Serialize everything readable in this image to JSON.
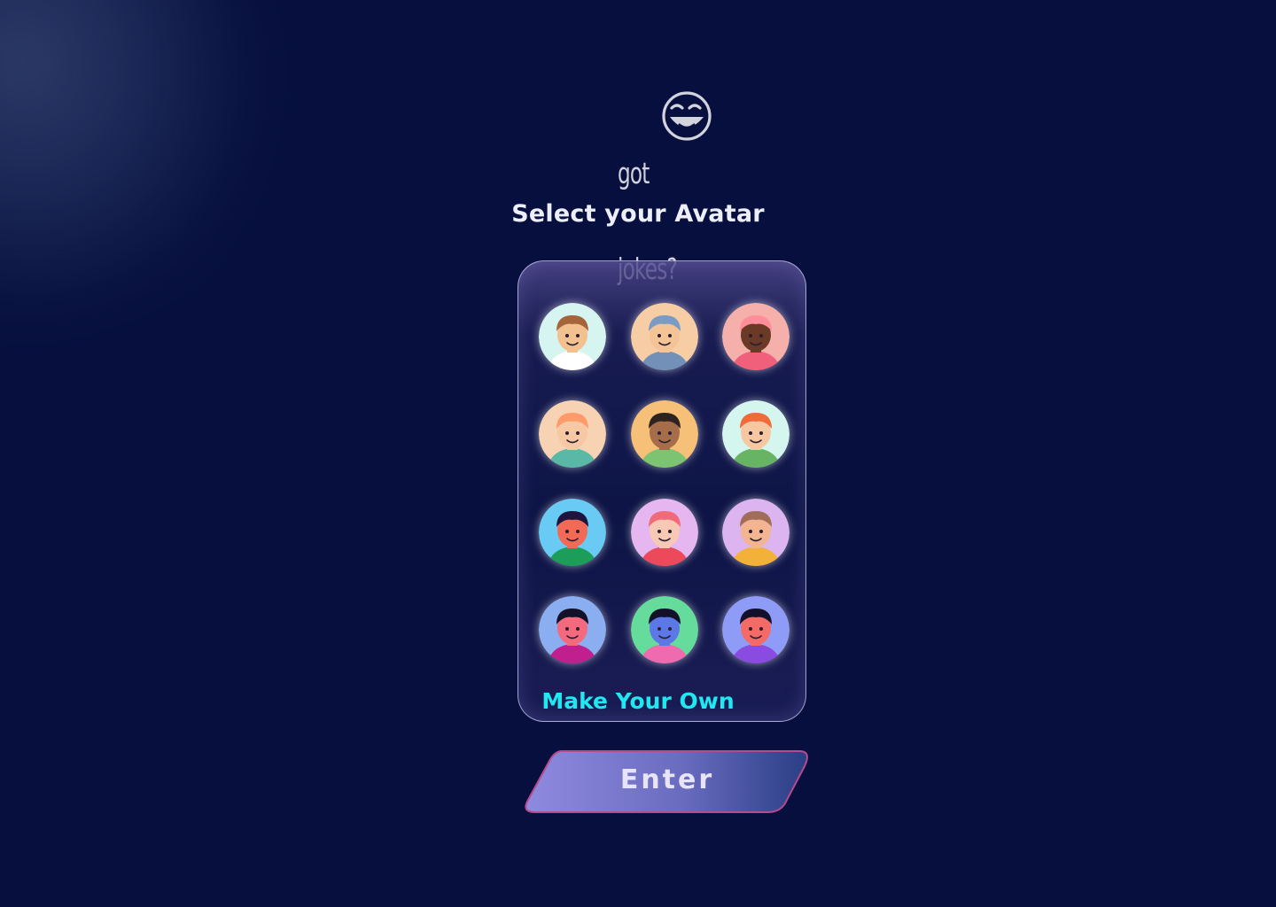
{
  "logo": {
    "line1": "got",
    "line2": "jokes?",
    "icon": "laughing-face-icon"
  },
  "title": "Select your Avatar",
  "avatars": [
    {
      "name": "avatar-1",
      "bg": "#d6f5f0",
      "skin": "#f2c18f",
      "hair": "#a4653a",
      "shirt": "#ffffff"
    },
    {
      "name": "avatar-2",
      "bg": "#f6cda4",
      "skin": "#f4c396",
      "hair": "#7a9bc4",
      "shirt": "#7391b8"
    },
    {
      "name": "avatar-3",
      "bg": "#f5b0ac",
      "skin": "#6b3a26",
      "hair": "#ff8e9a",
      "shirt": "#f0607a"
    },
    {
      "name": "avatar-4",
      "bg": "#f7d3b4",
      "skin": "#f6c8a4",
      "hair": "#ff9a6a",
      "shirt": "#59b9a6"
    },
    {
      "name": "avatar-5",
      "bg": "#f7c079",
      "skin": "#a56d4a",
      "hair": "#2f2320",
      "shirt": "#7cc471"
    },
    {
      "name": "avatar-6",
      "bg": "#d5f6ee",
      "skin": "#f7c7a2",
      "hair": "#f06a3a",
      "shirt": "#67b464"
    },
    {
      "name": "avatar-7",
      "bg": "#69cbf3",
      "skin": "#f26a55",
      "hair": "#1d1540",
      "shirt": "#1c9e5a"
    },
    {
      "name": "avatar-8",
      "bg": "#e5b6f0",
      "skin": "#f7c9b5",
      "hair": "#f06a7a",
      "shirt": "#ec4a5a"
    },
    {
      "name": "avatar-9",
      "bg": "#dcb5f0",
      "skin": "#f3b591",
      "hair": "#a06d58",
      "shirt": "#f3b13a"
    },
    {
      "name": "avatar-10",
      "bg": "#8aaef0",
      "skin": "#f36a7f",
      "hair": "#13102a",
      "shirt": "#c11f8e"
    },
    {
      "name": "avatar-11",
      "bg": "#65dc9b",
      "skin": "#5b78e6",
      "hair": "#13102a",
      "shirt": "#f06ab0"
    },
    {
      "name": "avatar-12",
      "bg": "#8f9cf7",
      "skin": "#f36a66",
      "hair": "#13102a",
      "shirt": "#8a4be0"
    }
  ],
  "make_own_label": "Make Your Own",
  "enter_label": "Enter",
  "colors": {
    "background": "#060f3e",
    "accent": "#1fe8f0",
    "button_gradient_start": "#8f8ae0",
    "button_gradient_end": "#2a3e85"
  }
}
